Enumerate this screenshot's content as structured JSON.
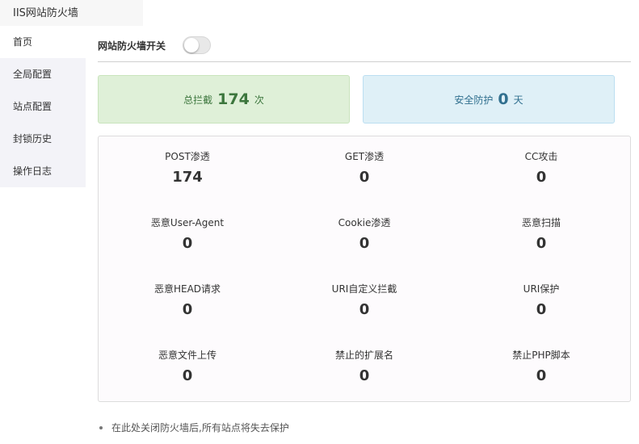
{
  "window": {
    "title": "IIS网站防火墙"
  },
  "sidebar": {
    "items": [
      {
        "label": "首页"
      },
      {
        "label": "全局配置"
      },
      {
        "label": "站点配置"
      },
      {
        "label": "封锁历史"
      },
      {
        "label": "操作日志"
      }
    ]
  },
  "firewall_switch": {
    "label": "网站防火墙开关",
    "enabled": false
  },
  "summary": {
    "total_block": {
      "label": "总拦截",
      "value": "174",
      "unit": "次",
      "color": "#3c763d"
    },
    "safe_days": {
      "label": "安全防护",
      "value": "0",
      "unit": "天",
      "color": "#31708f"
    }
  },
  "stats": [
    {
      "label": "POST渗透",
      "value": "174"
    },
    {
      "label": "GET渗透",
      "value": "0"
    },
    {
      "label": "CC攻击",
      "value": "0"
    },
    {
      "label": "恶意User-Agent",
      "value": "0"
    },
    {
      "label": "Cookie渗透",
      "value": "0"
    },
    {
      "label": "恶意扫描",
      "value": "0"
    },
    {
      "label": "恶意HEAD请求",
      "value": "0"
    },
    {
      "label": "URI自定义拦截",
      "value": "0"
    },
    {
      "label": "URI保护",
      "value": "0"
    },
    {
      "label": "恶意文件上传",
      "value": "0"
    },
    {
      "label": "禁止的扩展名",
      "value": "0"
    },
    {
      "label": "禁止PHP脚本",
      "value": "0"
    }
  ],
  "notes": [
    {
      "text": "在此处关闭防火墙后,所有站点将失去保护"
    }
  ]
}
